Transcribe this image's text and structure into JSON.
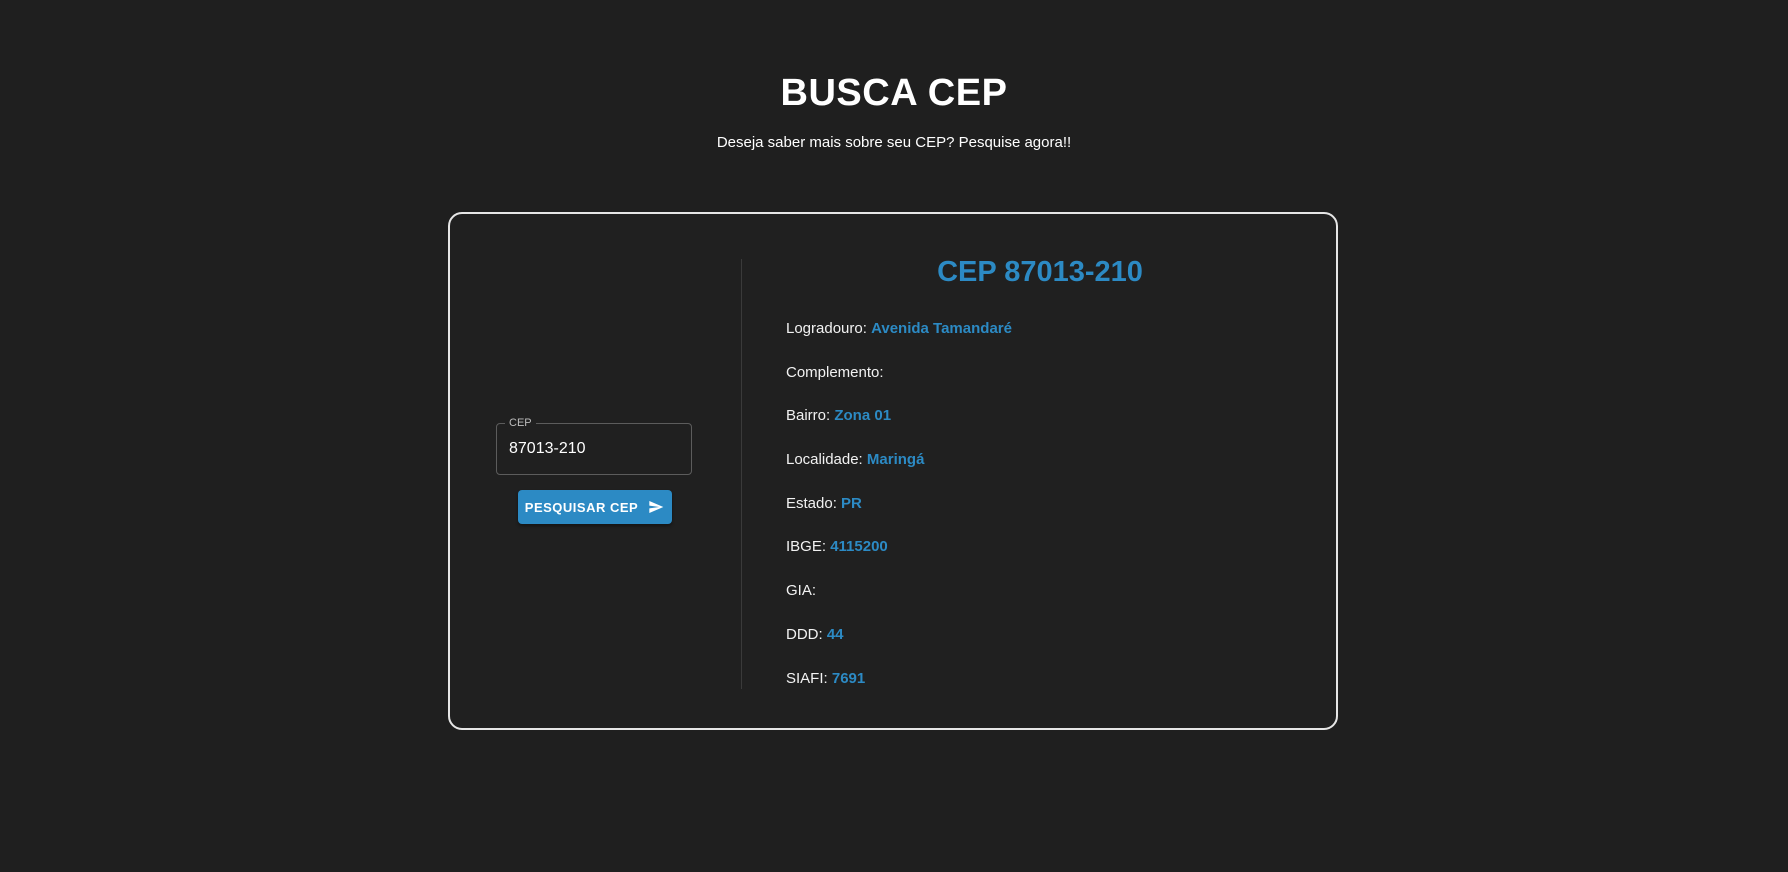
{
  "header": {
    "title": "BUSCA CEP",
    "subtitle": "Deseja saber mais sobre seu CEP? Pesquise agora!!"
  },
  "search": {
    "label": "CEP",
    "value": "87013-210",
    "button_label": "PESQUISAR CEP",
    "button_icon": "send-icon"
  },
  "result": {
    "title": "CEP 87013-210",
    "fields": [
      {
        "label": "Logradouro:",
        "value": "Avenida Tamandaré"
      },
      {
        "label": "Complemento:",
        "value": ""
      },
      {
        "label": "Bairro:",
        "value": "Zona 01"
      },
      {
        "label": "Localidade:",
        "value": "Maringá"
      },
      {
        "label": "Estado:",
        "value": "PR"
      },
      {
        "label": "IBGE:",
        "value": "4115200"
      },
      {
        "label": "GIA:",
        "value": ""
      },
      {
        "label": "DDD:",
        "value": "44"
      },
      {
        "label": "SIAFI:",
        "value": "7691"
      }
    ]
  },
  "colors": {
    "background": "#1f1f1f",
    "accent": "#2c8ac4",
    "card_border": "#e6e6e6",
    "text": "#ffffff"
  }
}
